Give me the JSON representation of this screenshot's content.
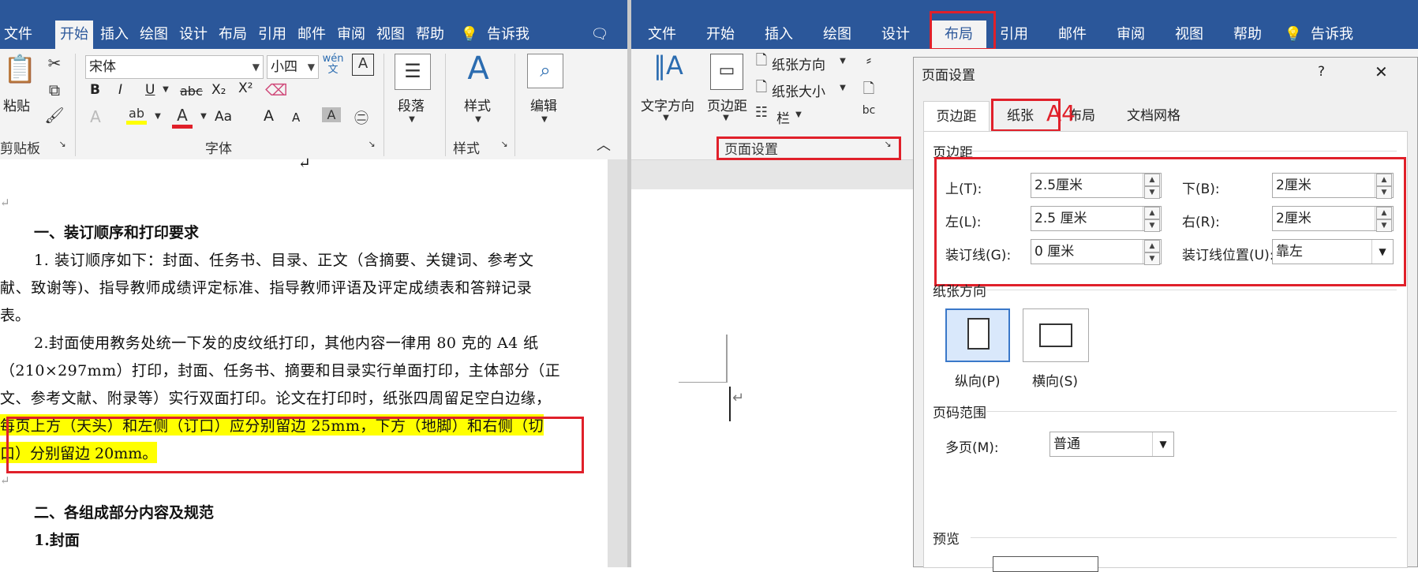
{
  "left_window": {
    "tabs": [
      "文件",
      "开始",
      "插入",
      "绘图",
      "设计",
      "布局",
      "引用",
      "邮件",
      "审阅",
      "视图",
      "帮助"
    ],
    "active_tab": "开始",
    "tell_me": "告诉我",
    "clipboard": {
      "paste_label": "粘贴",
      "group_label": "剪贴板"
    },
    "font": {
      "family": "宋体",
      "size": "小四",
      "wen_icon": "wén\n文",
      "bold": "B",
      "italic": "I",
      "underline": "U",
      "strike": "abc",
      "subscript": "X₂",
      "superscript": "X²",
      "change_case": "Aa",
      "grow": "A",
      "shrink": "A",
      "group_label": "字体"
    },
    "paragraph_label": "段落",
    "styles": {
      "label": "样式",
      "group_label": "样式"
    },
    "editing_label": "编辑",
    "document": {
      "lines": [
        {
          "text": "↵",
          "indent": 0
        },
        {
          "text": "一、装订顺序和打印要求",
          "bold": true
        },
        {
          "text": "1. 装订顺序如下：封面、任务书、目录、正文（含摘要、关键词、参考文"
        },
        {
          "text": "献、致谢等)、指导教师成绩评定标准、指导教师评语及评定成绩表和答辩记录"
        },
        {
          "text": "表。"
        },
        {
          "text": "2.封面使用教务处统一下发的皮纹纸打印，其他内容一律用 80 克的 A4 纸"
        },
        {
          "text": "（210×297mm）打印，封面、任务书、摘要和目录实行单面打印，主体部分（正"
        },
        {
          "text": "文、参考文献、附录等）实行双面打印。论文在打印时，纸张四周留足空白边缘，"
        },
        {
          "text": "每页上方（天头）和左侧（订口）应分别留边 25mm，下方（地脚）和右侧（切",
          "highlight": true
        },
        {
          "text": "口）分别留边 20mm。",
          "highlight": true
        },
        {
          "text": ""
        },
        {
          "text": "二、各组成部分内容及规范",
          "bold": true
        },
        {
          "text": "1.封面",
          "bold": true
        }
      ],
      "return_mark": "↵"
    }
  },
  "right_window": {
    "tabs": [
      "文件",
      "开始",
      "插入",
      "绘图",
      "设计",
      "布局",
      "引用",
      "邮件",
      "审阅",
      "视图",
      "帮助"
    ],
    "active_tab": "布局",
    "tell_me": "告诉我",
    "ribbon": {
      "text_direction": "文字方向",
      "margins": "页边距",
      "orientation": "纸张方向",
      "size": "纸张大小",
      "columns": "栏",
      "group_label": "页面设置"
    }
  },
  "dialog": {
    "title": "页面设置",
    "help": "?",
    "close": "✕",
    "tabs": [
      "页边距",
      "纸张",
      "布局",
      "文档网格"
    ],
    "active_tab": "页边距",
    "annotation": "A4",
    "margins_section": "页边距",
    "fields": {
      "top_label": "上(T):",
      "top_value": "2.5厘米",
      "bottom_label": "下(B):",
      "bottom_value": "2厘米",
      "left_label": "左(L):",
      "left_value": "2.5 厘米",
      "right_label": "右(R):",
      "right_value": "2厘米",
      "gutter_label": "装订线(G):",
      "gutter_value": "0 厘米",
      "gutter_pos_label": "装订线位置(U):",
      "gutter_pos_value": "靠左"
    },
    "orientation_section": "纸张方向",
    "portrait": "纵向(P)",
    "landscape": "横向(S)",
    "pages_section": "页码范围",
    "multiple_pages_label": "多页(M):",
    "multiple_pages_value": "普通",
    "preview_section": "预览"
  },
  "colors": {
    "ribbon_blue": "#2b579a",
    "highlight": "#ffff00",
    "annotation_red": "#e0202a"
  }
}
